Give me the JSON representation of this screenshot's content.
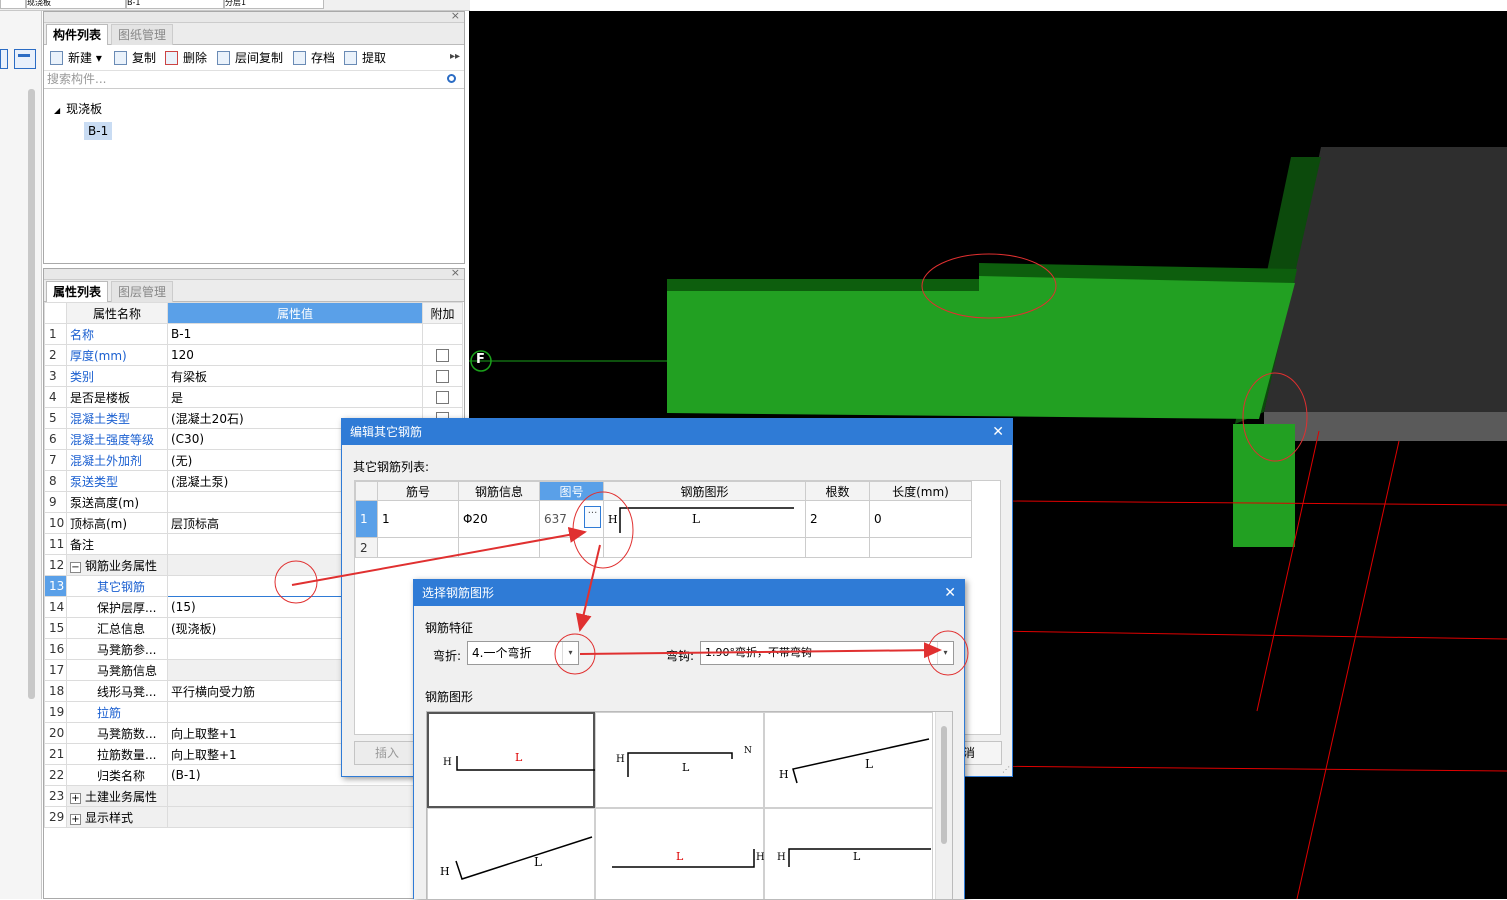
{
  "top_strip": {
    "c1": "现浇板",
    "c2": "B-1",
    "c3": "分层1"
  },
  "component_panel": {
    "tabs": [
      "构件列表",
      "图纸管理"
    ],
    "toolbar": {
      "new": "新建",
      "copy": "复制",
      "delete": "删除",
      "floor_copy": "层间复制",
      "save": "存档",
      "extract": "提取"
    },
    "search_placeholder": "搜索构件...",
    "tree": {
      "root": "现浇板",
      "child": "B-1"
    }
  },
  "property_panel": {
    "tabs": [
      "属性列表",
      "图层管理"
    ],
    "headers": {
      "name": "属性名称",
      "value": "属性值",
      "extra": "附加"
    },
    "rows": [
      {
        "n": "1",
        "name": "名称",
        "value": "B-1",
        "blue": true,
        "chk": false
      },
      {
        "n": "2",
        "name": "厚度(mm)",
        "value": "120",
        "blue": true,
        "chk": true
      },
      {
        "n": "3",
        "name": "类别",
        "value": "有梁板",
        "blue": true,
        "chk": true
      },
      {
        "n": "4",
        "name": "是否是楼板",
        "value": "是",
        "blue": false,
        "chk": true
      },
      {
        "n": "5",
        "name": "混凝土类型",
        "value": "(混凝土20石)",
        "blue": true,
        "chk": true
      },
      {
        "n": "6",
        "name": "混凝土强度等级",
        "value": "(C30)",
        "blue": true,
        "chk": true
      },
      {
        "n": "7",
        "name": "混凝土外加剂",
        "value": "(无)",
        "blue": true,
        "chk": false
      },
      {
        "n": "8",
        "name": "泵送类型",
        "value": "(混凝土泵)",
        "blue": true,
        "chk": false
      },
      {
        "n": "9",
        "name": "泵送高度(m)",
        "value": "",
        "blue": false,
        "chk": false
      },
      {
        "n": "10",
        "name": "顶标高(m)",
        "value": "层顶标高",
        "blue": false,
        "chk": false
      },
      {
        "n": "11",
        "name": "备注",
        "value": "",
        "blue": false,
        "chk": false
      },
      {
        "n": "12",
        "name": "钢筋业务属性",
        "value": "",
        "group": "minus"
      },
      {
        "n": "13",
        "name": "其它钢筋",
        "value": "",
        "blue": true,
        "indent": true,
        "selected": true
      },
      {
        "n": "14",
        "name": "保护层厚...",
        "value": "(15)",
        "indent": true
      },
      {
        "n": "15",
        "name": "汇总信息",
        "value": "(现浇板)",
        "indent": true
      },
      {
        "n": "16",
        "name": "马凳筋参...",
        "value": "",
        "indent": true
      },
      {
        "n": "17",
        "name": "马凳筋信息",
        "value": "",
        "indent": true,
        "grey": true
      },
      {
        "n": "18",
        "name": "线形马凳...",
        "value": "平行横向受力筋",
        "indent": true
      },
      {
        "n": "19",
        "name": "拉筋",
        "value": "",
        "blue": true,
        "indent": true
      },
      {
        "n": "20",
        "name": "马凳筋数...",
        "value": "向上取整+1",
        "indent": true
      },
      {
        "n": "21",
        "name": "拉筋数量...",
        "value": "向上取整+1",
        "indent": true
      },
      {
        "n": "22",
        "name": "归类名称",
        "value": "(B-1)",
        "indent": true
      },
      {
        "n": "23",
        "name": "土建业务属性",
        "value": "",
        "group": "plus"
      },
      {
        "n": "29",
        "name": "显示样式",
        "value": "",
        "group": "plus"
      }
    ]
  },
  "viewport": {
    "axis_label": "F"
  },
  "edit_rebar_dialog": {
    "title": "编辑其它钢筋",
    "list_label": "其它钢筋列表:",
    "headers": [
      "筋号",
      "钢筋信息",
      "图号",
      "钢筋图形",
      "根数",
      "长度(mm)"
    ],
    "rows": [
      {
        "n": "1",
        "id": "1",
        "info": "Φ20",
        "fig": "637",
        "shape_h": "H",
        "shape_l": "L",
        "count": "2",
        "len": "0"
      },
      {
        "n": "2",
        "id": "",
        "info": "",
        "fig": "",
        "shape_h": "",
        "shape_l": "",
        "count": "",
        "len": ""
      }
    ],
    "insert_label": "插入",
    "cancel_fragment": "消"
  },
  "select_shape_dialog": {
    "title": "选择钢筋图形",
    "feature_label": "钢筋特征",
    "bend_label": "弯折:",
    "bend_value": "4.一个弯折",
    "hook_label": "弯钩:",
    "hook_value": "1.90°弯折，不带弯钩",
    "shape_label": "钢筋图形",
    "shapes": [
      {
        "h": "H",
        "l": "L",
        "n": ""
      },
      {
        "h": "H",
        "l": "L",
        "n": "N"
      },
      {
        "h": "H",
        "l": "L",
        "n": ""
      },
      {
        "h": "H",
        "l": "L",
        "n": ""
      },
      {
        "h": "H",
        "l": "L",
        "n": ""
      },
      {
        "h": "H",
        "l": "L",
        "n": ""
      }
    ]
  },
  "colors": {
    "accent": "#2f7bd6",
    "slab_green": "#1f9e1f",
    "annotation_red": "#e03030",
    "grid_red": "#e00000"
  }
}
